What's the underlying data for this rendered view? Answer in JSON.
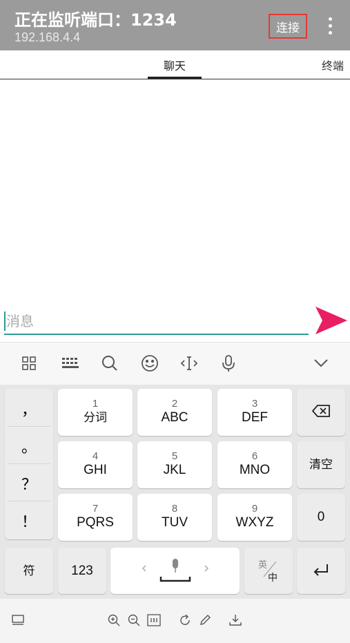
{
  "header": {
    "title": "正在监听端口：1234",
    "ip": "192.168.4.4",
    "connect_label": "连接"
  },
  "tabs": [
    "聊天",
    "终端"
  ],
  "message": {
    "placeholder": "消息",
    "value": ""
  },
  "colors": {
    "appbar": "#9b9b9b",
    "accent": "#2a9d8f",
    "send": "#e91e63",
    "highlight": "#e53935"
  },
  "keyboard": {
    "toolbar_icons": [
      "grid-icon",
      "keyboard-icon",
      "search-icon",
      "emoji-icon",
      "cursor-move-icon",
      "microphone-icon",
      "collapse-icon"
    ],
    "punct": [
      "，",
      "。",
      "？",
      "！"
    ],
    "rows": [
      [
        {
          "num": "1",
          "letters": "分词"
        },
        {
          "num": "2",
          "letters": "ABC"
        },
        {
          "num": "3",
          "letters": "DEF"
        }
      ],
      [
        {
          "num": "4",
          "letters": "GHI"
        },
        {
          "num": "5",
          "letters": "JKL"
        },
        {
          "num": "6",
          "letters": "MNO"
        }
      ],
      [
        {
          "num": "7",
          "letters": "PQRS"
        },
        {
          "num": "8",
          "letters": "TUV"
        },
        {
          "num": "9",
          "letters": "WXYZ"
        }
      ]
    ],
    "clear": "清空",
    "zero": "0",
    "symbol": "符",
    "num123": "123",
    "lang_top": "英",
    "lang_bottom": "中"
  },
  "bottom_icons": [
    "screen-icon",
    "zoom-in-icon",
    "zoom-out-icon",
    "actual-size-icon",
    "rotate-icon",
    "edit-icon",
    "download-icon"
  ]
}
